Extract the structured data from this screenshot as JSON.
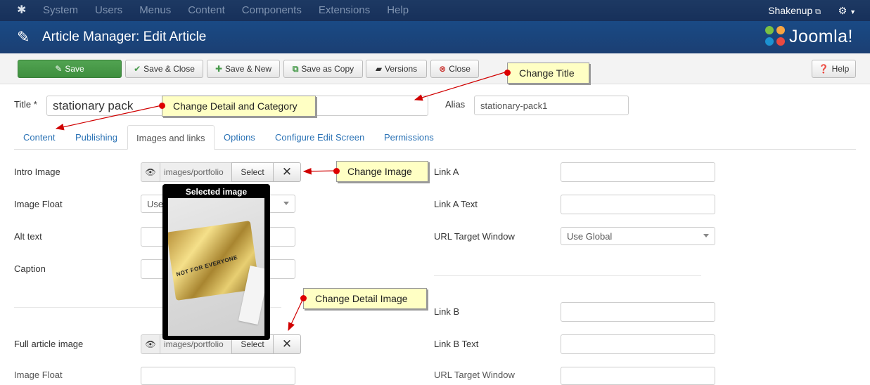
{
  "topnav": {
    "menu": [
      "System",
      "Users",
      "Menus",
      "Content",
      "Components",
      "Extensions",
      "Help"
    ],
    "user": "Shakenup",
    "user_icon": "external-link-icon",
    "settings_icon": "gear-icon"
  },
  "header": {
    "title": "Article Manager: Edit Article",
    "brand": "Joomla!",
    "colors": {
      "nav": "#17305a",
      "header": "#1b3f73"
    }
  },
  "toolbar": {
    "save": "Save",
    "save_close": "Save & Close",
    "save_new": "Save & New",
    "save_copy": "Save as Copy",
    "versions": "Versions",
    "close": "Close",
    "help": "Help",
    "save_color": "#46994a"
  },
  "form": {
    "title_label": "Title *",
    "title_value": "stationary pack",
    "alias_label": "Alias",
    "alias_value": "stationary-pack1"
  },
  "tabs": [
    "Content",
    "Publishing",
    "Images and links",
    "Options",
    "Configure Edit Screen",
    "Permissions"
  ],
  "images": {
    "intro_label": "Intro Image",
    "intro_path": "images/portfolio",
    "select": "Select",
    "float_label": "Image Float",
    "float_value": "Use",
    "alt_label": "Alt text",
    "caption_label": "Caption",
    "full_label": "Full article image",
    "full_path": "images/portfolio",
    "popover_title": "Selected image",
    "popover_image_text": "NOT FOR EVERYONE"
  },
  "links": {
    "link_a": "Link A",
    "link_a_text": "Link A Text",
    "url_target": "URL Target Window",
    "url_target_value": "Use Global",
    "link_b": "Link B",
    "link_b_text": "Link B Text"
  },
  "callouts": {
    "change_title": "Change Title",
    "change_detail_category": "Change Detail and Category",
    "change_image": "Change Image",
    "change_detail_image": "Change Detail Image",
    "color": "#ffffc4",
    "arrow_color": "#d00000"
  }
}
